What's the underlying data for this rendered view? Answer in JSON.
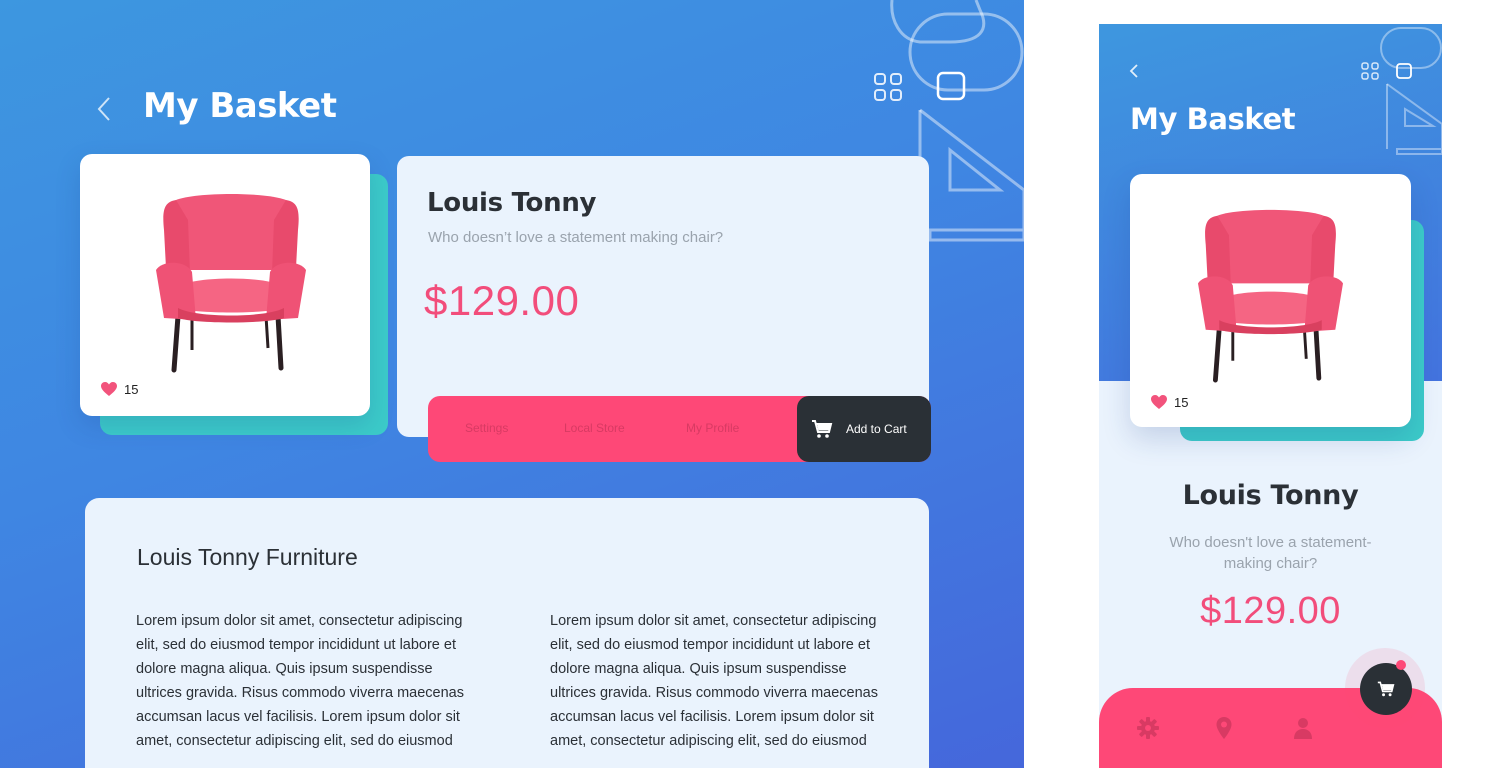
{
  "colors": {
    "accent_pink": "#fe4877",
    "price_pink": "#f24d7b",
    "teal": "#3ccbc9",
    "dark": "#2a3036",
    "card_bg": "#eaf3fd",
    "gradient_blue": "#3f86e2"
  },
  "header": {
    "title": "My Basket",
    "back_icon": "chevron-left-icon",
    "grid_icon": "grid-icon",
    "square_icon": "square-icon"
  },
  "product": {
    "name": "Louis Tonny",
    "description": "Who doesn’t love a statement making chair?",
    "price": "$129.00",
    "likes": "15",
    "image": "pink-armchair"
  },
  "action_bar": {
    "links": [
      "Settings",
      "Local Store",
      "My Profile"
    ],
    "cart_label": "Add to Cart",
    "cart_icon": "cart-icon"
  },
  "about": {
    "title": "Louis Tonny Furniture",
    "paragraphs": [
      "Lorem ipsum dolor sit amet, consectetur adipiscing elit, sed do eiusmod tempor incididunt ut labore et dolore magna aliqua. Quis ipsum suspendisse ultrices gravida. Risus commodo viverra maecenas accumsan lacus vel facilisis.  Lorem ipsum dolor sit amet, consectetur adipiscing elit, sed do eiusmod",
      "Lorem ipsum dolor sit amet, consectetur adipiscing elit, sed do eiusmod tempor incididunt ut labore et dolore magna aliqua. Quis ipsum suspendisse ultrices gravida. Risus commodo viverra maecenas accumsan lacus vel facilisis.  Lorem ipsum dolor sit amet, consectetur adipiscing elit, sed do eiusmod"
    ]
  },
  "mobile": {
    "title": "My Basket",
    "name": "Louis Tonny",
    "description": "Who doesn't love a statement-making chair?",
    "price": "$129.00",
    "likes": "15",
    "nav_icons": [
      "gear-icon",
      "location-pin-icon",
      "user-icon"
    ],
    "fab_icon": "cart-icon"
  }
}
